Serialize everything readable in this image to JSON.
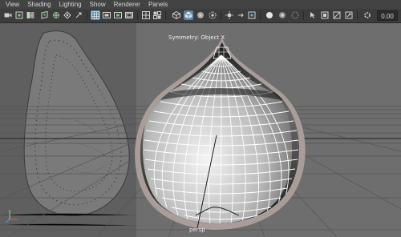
{
  "menubar": {
    "items": [
      "View",
      "Shading",
      "Lighting",
      "Show",
      "Renderer",
      "Panels"
    ]
  },
  "toolbar": {
    "tools": [
      "camera-icon",
      "camera-attributes-icon",
      "bookmark-icon",
      "image-plane-icon",
      "grid-icon",
      "film-gate-icon",
      "resolution-gate-icon",
      "gate-mask-icon",
      "field-chart-icon",
      "safe-action-icon",
      "safe-title-icon",
      "wireframe-icon",
      "smooth-shade-icon",
      "wireframe-on-shaded-icon",
      "textured-icon",
      "use-all-lights-icon",
      "shadows-icon",
      "screen-space-ao-icon",
      "motion-blur-icon",
      "multisample-aa-icon",
      "depth-of-field-icon",
      "isolate-select-icon",
      "xray-icon",
      "xray-joints-icon",
      "xray-components-icon",
      "exposure-icon",
      "gamma-icon"
    ],
    "zoom_value": "0.00"
  },
  "viewport": {
    "symmetry_label": "Symmetry: Object X",
    "camera_label": "persp",
    "accent_color": "#5285a6",
    "mesh_color": "#ffffff",
    "mesh_border_color": "#a99d99"
  }
}
